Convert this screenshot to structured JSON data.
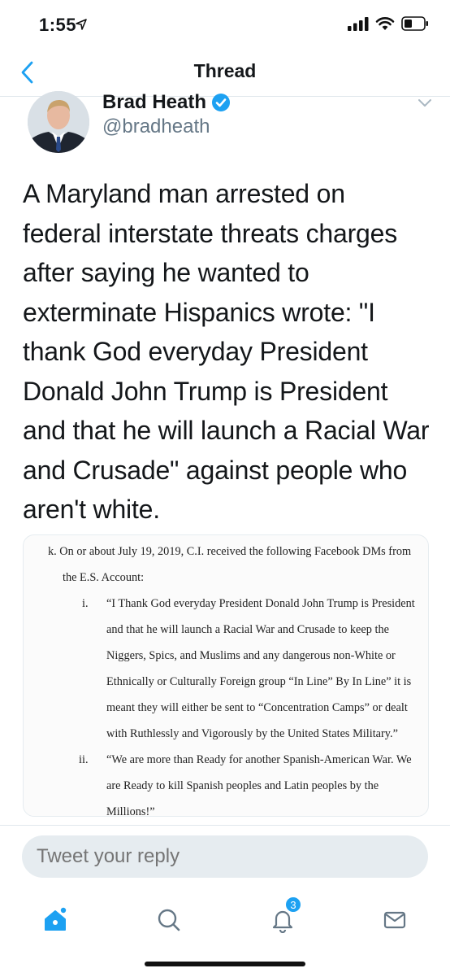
{
  "status": {
    "time": "1:55"
  },
  "nav": {
    "title": "Thread"
  },
  "tweet": {
    "author_name": "Brad Heath",
    "handle": "@bradheath",
    "text": "A Maryland man arrested on federal interstate threats charges after saying he wanted to exterminate Hispanics wrote: \"I thank God everyday President Donald John Trump is President and that he will launch a Racial War and Crusade\" against people who aren't white.",
    "text_lines": [
      "A Maryland man arrested on",
      "federal interstate threats charges",
      "after saying he wanted to",
      "exterminate Hispanics wrote: \"I",
      "thank God everyday President",
      "Donald John Trump is President",
      "and that he will launch a Racial War",
      "and Crusade\" against people who",
      "aren't white."
    ]
  },
  "document": {
    "lines": [
      "k.   On or about July 19, 2019, C.I. received the following Facebook DMs from",
      "the E.S. Account:",
      "i.",
      "“I Thank God everyday President Donald John Trump is President",
      "and that he will launch a Racial War and Crusade to keep the",
      "Niggers, Spics, and Muslims and any dangerous non-White or",
      "Ethnically or Culturally Foreign group “In Line” By In Line” it is",
      "meant they will either be sent to “Concentration Camps” or dealt",
      "with Ruthlessly and Vigorously by the United States Military.”",
      "ii.",
      "“We are more than Ready for another Spanish-American War. We",
      "are Ready to kill Spanish peoples and Latin peoples by the",
      "Millions!”"
    ]
  },
  "reply": {
    "placeholder": "Tweet your reply"
  },
  "tabs": {
    "notifications_badge": "3"
  },
  "colors": {
    "accent": "#1da1f2",
    "secondary_text": "#657786",
    "divider": "#e1e8ed"
  },
  "icons": {
    "back": "chevron-left-icon",
    "verified": "verified-badge-icon",
    "caret": "chevron-down-icon",
    "home": "home-icon",
    "search": "search-icon",
    "notifications": "bell-icon",
    "messages": "envelope-icon"
  }
}
